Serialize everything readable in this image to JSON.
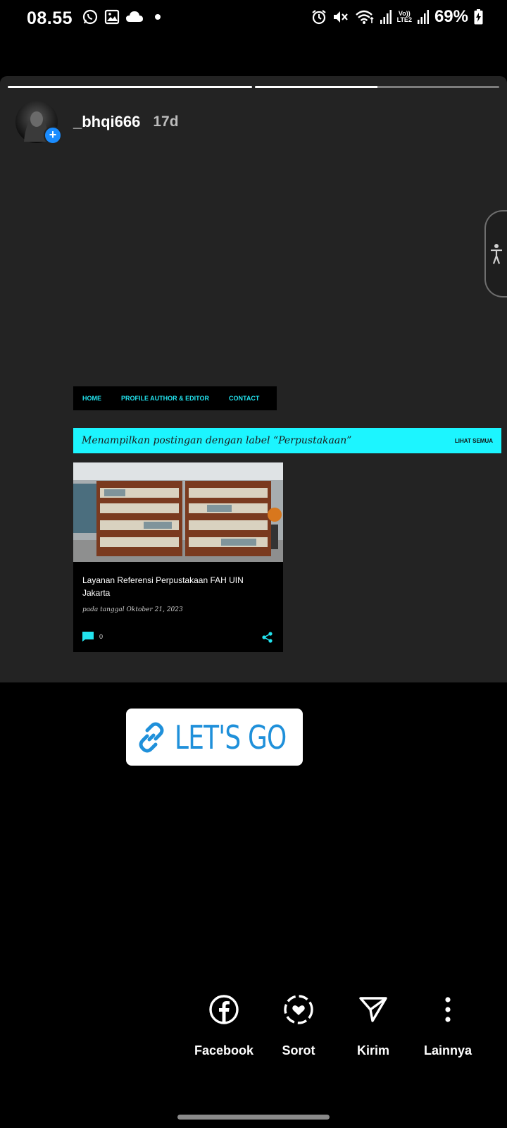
{
  "status_bar": {
    "time": "08.55",
    "left_icons": [
      "whatsapp-icon",
      "gallery-icon",
      "cloud-icon",
      "dot-icon"
    ],
    "right_icons": [
      "alarm-icon",
      "mute-icon",
      "wifi-icon",
      "signal-icon",
      "volte-lte2-icon",
      "signal-icon",
      "battery-charging-icon"
    ],
    "network_label_top": "Vo))",
    "network_label_bottom": "LTE2",
    "battery_percent": "69%"
  },
  "story": {
    "progress_segments": [
      1.0,
      0.5
    ],
    "username": "_bhqi666",
    "age": "17d",
    "avatar_badge": "+"
  },
  "embedded_page": {
    "nav": [
      "HOME",
      "PROFILE AUTHOR & EDITOR",
      "CONTACT"
    ],
    "label_title": "Menampilkan postingan dengan label “Perpustakaan”",
    "label_link": "LIHAT SEMUA",
    "post": {
      "title": "Layanan Referensi Perpustakaan FAH UIN Jakarta",
      "date": "pada tanggal Oktober 21, 2023",
      "comment_count": "0"
    },
    "accent": "#1cf5ff"
  },
  "link_sticker": {
    "label": "LET'S GO",
    "icon": "link-icon",
    "color": "#1f90da"
  },
  "actions": [
    {
      "label": "Facebook",
      "icon": "facebook-icon"
    },
    {
      "label": "Sorot",
      "icon": "highlight-icon"
    },
    {
      "label": "Kirim",
      "icon": "send-icon"
    },
    {
      "label": "Lainnya",
      "icon": "more-vertical-icon"
    }
  ]
}
